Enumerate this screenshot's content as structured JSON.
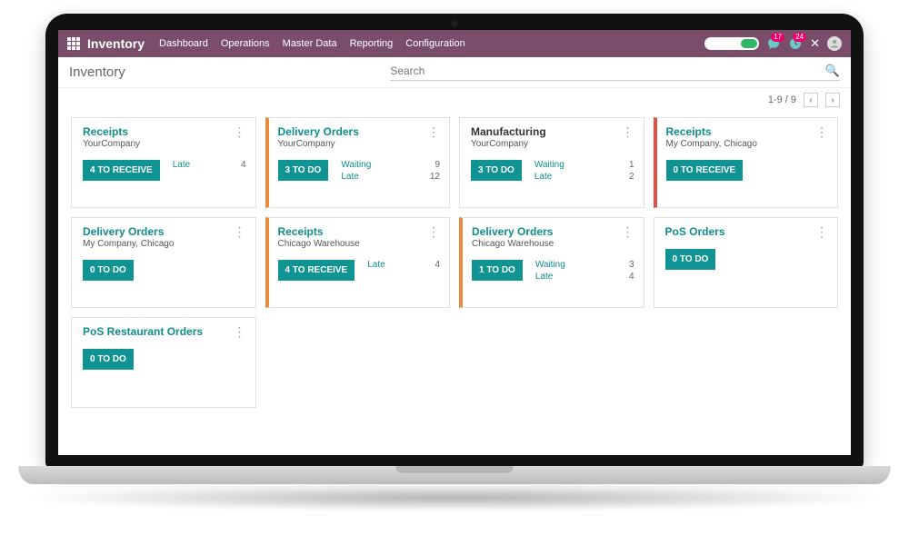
{
  "brand": "Inventory",
  "menu": [
    "Dashboard",
    "Operations",
    "Master Data",
    "Reporting",
    "Configuration"
  ],
  "badges": {
    "msg": "17",
    "activity": "24"
  },
  "breadcrumb": "Inventory",
  "search": {
    "placeholder": "Search"
  },
  "pager": {
    "range": "1-9 / 9"
  },
  "cards": [
    {
      "title": "Receipts",
      "titleDark": false,
      "subtitle": "YourCompany",
      "action": "4 TO RECEIVE",
      "bar": "",
      "stats": [
        {
          "label": "Late",
          "value": "4"
        }
      ]
    },
    {
      "title": "Delivery Orders",
      "titleDark": false,
      "subtitle": "YourCompany",
      "action": "3 TO DO",
      "bar": "orange",
      "stats": [
        {
          "label": "Waiting",
          "value": "9"
        },
        {
          "label": "Late",
          "value": "12"
        }
      ]
    },
    {
      "title": "Manufacturing",
      "titleDark": true,
      "subtitle": "YourCompany",
      "action": "3 TO DO",
      "bar": "",
      "stats": [
        {
          "label": "Waiting",
          "value": "1"
        },
        {
          "label": "Late",
          "value": "2"
        }
      ]
    },
    {
      "title": "Receipts",
      "titleDark": false,
      "subtitle": "My Company, Chicago",
      "action": "0 TO RECEIVE",
      "bar": "red",
      "stats": []
    },
    {
      "title": "Delivery Orders",
      "titleDark": false,
      "subtitle": "My Company, Chicago",
      "action": "0 TO DO",
      "bar": "",
      "stats": []
    },
    {
      "title": "Receipts",
      "titleDark": false,
      "subtitle": "Chicago Warehouse",
      "action": "4 TO RECEIVE",
      "bar": "orange",
      "stats": [
        {
          "label": "Late",
          "value": "4"
        }
      ]
    },
    {
      "title": "Delivery Orders",
      "titleDark": false,
      "subtitle": "Chicago Warehouse",
      "action": "1 TO DO",
      "bar": "orange",
      "stats": [
        {
          "label": "Waiting",
          "value": "3"
        },
        {
          "label": "Late",
          "value": "4"
        }
      ]
    },
    {
      "title": "PoS Orders",
      "titleDark": false,
      "subtitle": "",
      "action": "0 TO DO",
      "bar": "",
      "stats": []
    },
    {
      "title": "PoS Restaurant Orders",
      "titleDark": false,
      "subtitle": "",
      "action": "0 TO DO",
      "bar": "",
      "stats": []
    }
  ]
}
